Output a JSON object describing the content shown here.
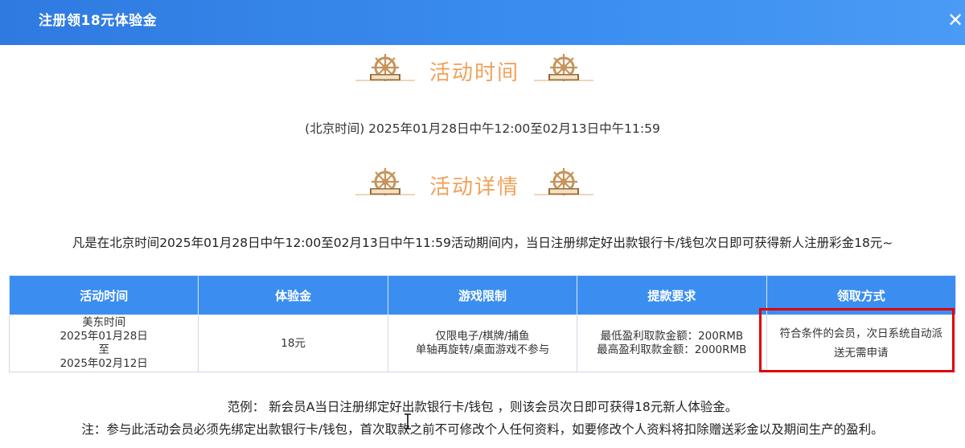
{
  "header": {
    "title": "注册领18元体验金",
    "close_icon": "close-icon"
  },
  "sections": {
    "time_title": "活动时间",
    "detail_title": "活动详情"
  },
  "time_text": "(北京时间) 2025年01月28日中午12:00至02月13日中午11:59",
  "detail_text": "凡是在北京时间2025年01月28日中午12:00至02月13日中午11:59活动期间内，当日注册绑定好出款银行卡/钱包次日即可获得新人注册彩金18元~",
  "table": {
    "headers": [
      "活动时间",
      "体验金",
      "游戏限制",
      "提款要求",
      "领取方式"
    ],
    "row": {
      "time": [
        "美东时间",
        "2025年01月28日",
        "至",
        "2025年02月12日"
      ],
      "amount": "18元",
      "limits": [
        "仅限电子/棋牌/捕鱼",
        "单轴再旋转/桌面游戏不参与"
      ],
      "withdraw": [
        "最低盈利取款金额：200RMB",
        "最高盈利取款金额：2000RMB"
      ],
      "claim": [
        "符合条件的会员，次日系统自动派",
        "送无需申请"
      ]
    }
  },
  "notes": {
    "example": "范例：  新会员A当日注册绑定好出款银行卡/钱包 ，则该会员次日即可获得18元新人体验金。",
    "note": "注：参与此活动会员必须先绑定出款银行卡/钱包，首次取款之前不可修改个人任何资料，如要修改个人资料将扣除赠送彩金以及期间生产的盈利。"
  },
  "colors": {
    "header_blue": "#3b8ef0",
    "banner_orange": "#f0a25a",
    "highlight_red": "#e00000"
  }
}
